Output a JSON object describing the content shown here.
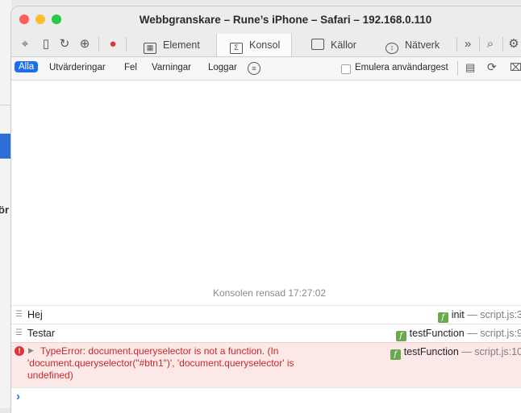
{
  "window": {
    "title": "Webbgranskare – Rune’s iPhone – Safari – 192.168.0.110",
    "traffic_lights": [
      "#fe5f57",
      "#febc2e",
      "#28c840"
    ]
  },
  "background": {
    "partial_text": "ör"
  },
  "tabs": [
    {
      "label": "Element",
      "icon": "element-icon"
    },
    {
      "label": "Konsol",
      "icon": "console-icon"
    },
    {
      "label": "Källor",
      "icon": "sources-icon"
    },
    {
      "label": "Nätverk",
      "icon": "network-icon"
    }
  ],
  "toolbar": {
    "more": "»",
    "active_tab": "Konsol"
  },
  "filters": {
    "items": [
      "Alla",
      "Utvärderingar",
      "Fel",
      "Varningar",
      "Loggar"
    ],
    "selected": "Alla",
    "emulate_label": "Emulera användargest"
  },
  "console": {
    "cleared_text": "Konsolen rensad 17:27:02",
    "messages": [
      {
        "text": "Hej",
        "function": "init",
        "location": "script.js:3"
      },
      {
        "text": "Testar",
        "function": "testFunction",
        "location": "script.js:9"
      }
    ],
    "error": {
      "line1": "TypeError: document.queryselector is not a function. (In",
      "line2": "'document.queryselector(\"#btn1\")', 'document.queryselector' is",
      "line3": "undefined)",
      "function": "testFunction",
      "location": "script.js:10"
    },
    "separator": "—",
    "prompt": "›"
  },
  "colors": {
    "accent": "#1e6ff0",
    "error_bg": "#fde8e8",
    "error_text": "#c52a2a",
    "function_badge": "#6aa84f"
  }
}
